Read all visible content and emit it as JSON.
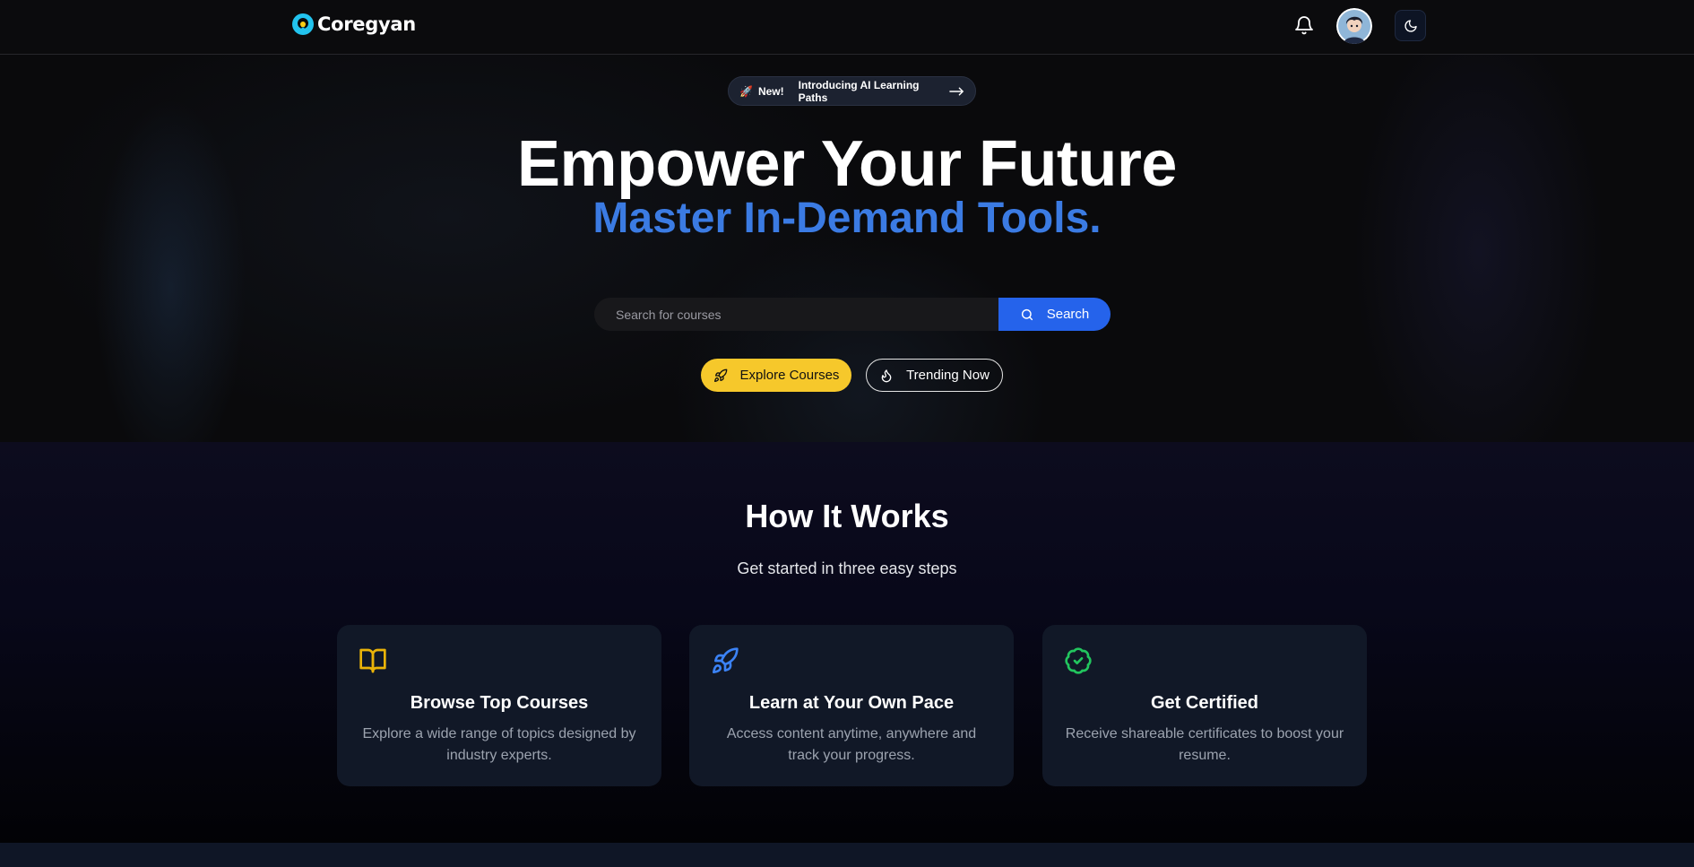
{
  "nav": {
    "brand": "Coregyan",
    "icons": [
      "bell-icon",
      "avatar",
      "moon-icon"
    ]
  },
  "hero": {
    "pill_new": "New!",
    "pill_text": "Introducing AI Learning Paths",
    "headline": "Empower Your Future",
    "subheadline": "Master In-Demand Tools.",
    "search_placeholder": "Search for courses",
    "search_value": "",
    "search_button": "Search",
    "explore_button": "Explore Courses",
    "trending_button": "Trending Now"
  },
  "how": {
    "title": "How It Works",
    "subtitle": "Get started in three easy steps",
    "cards": [
      {
        "icon": "book-icon",
        "title": "Browse Top Courses",
        "desc": "Explore a wide range of topics designed by industry experts."
      },
      {
        "icon": "rocket-icon",
        "title": "Learn at Your Own Pace",
        "desc": "Access content anytime, anywhere and track your progress."
      },
      {
        "icon": "badge-check-icon",
        "title": "Get Certified",
        "desc": "Receive shareable certificates to boost your resume."
      }
    ]
  },
  "colors": {
    "accent_blue": "#2563eb",
    "headline_blue": "#3b7be3",
    "explore_yellow": "#f6c82b",
    "card_bg": "#111827",
    "book_icon": "#eab308",
    "rocket_icon": "#3b82f6",
    "badge_icon": "#22c55e"
  }
}
